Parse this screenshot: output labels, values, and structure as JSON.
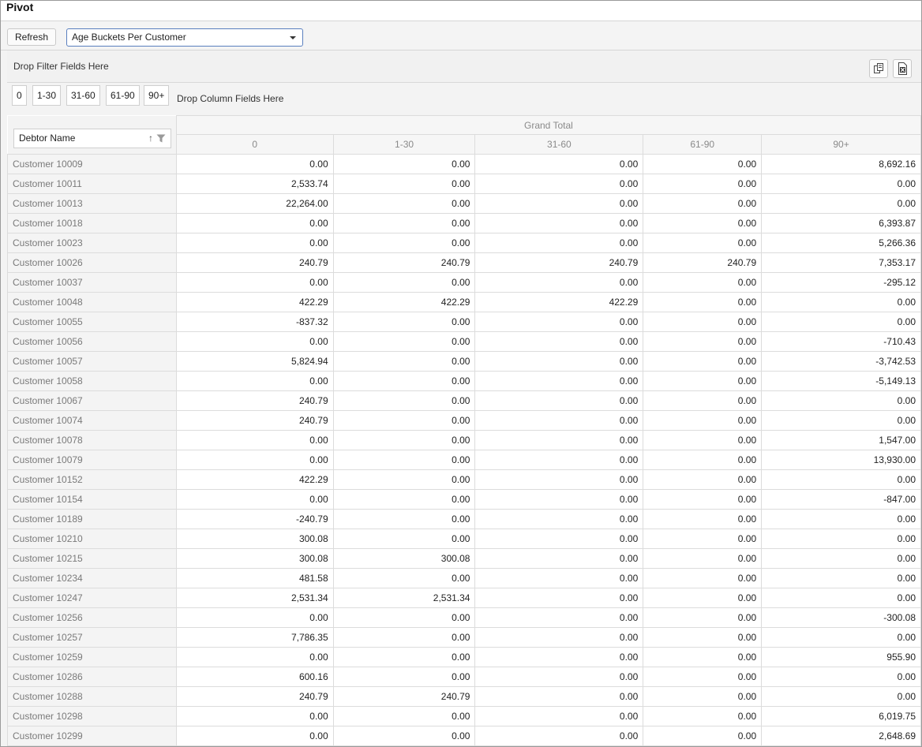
{
  "title": "Pivot",
  "toolbar": {
    "refresh_label": "Refresh",
    "report_select": "Age Buckets Per Customer"
  },
  "filter_zone": {
    "label": "Drop Filter Fields Here"
  },
  "column_zone": {
    "chips": [
      "0",
      "1-30",
      "31-60",
      "61-90",
      "90+"
    ],
    "label": "Drop Column Fields Here"
  },
  "row_field": {
    "label": "Debtor Name"
  },
  "grid": {
    "grand_total_label": "Grand Total",
    "columns": [
      "0",
      "1-30",
      "31-60",
      "61-90",
      "90+"
    ],
    "rows": [
      {
        "name": "Customer 10009",
        "values": [
          "0.00",
          "0.00",
          "0.00",
          "0.00",
          "8,692.16"
        ]
      },
      {
        "name": "Customer 10011",
        "values": [
          "2,533.74",
          "0.00",
          "0.00",
          "0.00",
          "0.00"
        ]
      },
      {
        "name": "Customer 10013",
        "values": [
          "22,264.00",
          "0.00",
          "0.00",
          "0.00",
          "0.00"
        ]
      },
      {
        "name": "Customer 10018",
        "values": [
          "0.00",
          "0.00",
          "0.00",
          "0.00",
          "6,393.87"
        ]
      },
      {
        "name": "Customer 10023",
        "values": [
          "0.00",
          "0.00",
          "0.00",
          "0.00",
          "5,266.36"
        ]
      },
      {
        "name": "Customer 10026",
        "values": [
          "240.79",
          "240.79",
          "240.79",
          "240.79",
          "7,353.17"
        ]
      },
      {
        "name": "Customer 10037",
        "values": [
          "0.00",
          "0.00",
          "0.00",
          "0.00",
          "-295.12"
        ]
      },
      {
        "name": "Customer 10048",
        "values": [
          "422.29",
          "422.29",
          "422.29",
          "0.00",
          "0.00"
        ]
      },
      {
        "name": "Customer 10055",
        "values": [
          "-837.32",
          "0.00",
          "0.00",
          "0.00",
          "0.00"
        ]
      },
      {
        "name": "Customer 10056",
        "values": [
          "0.00",
          "0.00",
          "0.00",
          "0.00",
          "-710.43"
        ]
      },
      {
        "name": "Customer 10057",
        "values": [
          "5,824.94",
          "0.00",
          "0.00",
          "0.00",
          "-3,742.53"
        ]
      },
      {
        "name": "Customer 10058",
        "values": [
          "0.00",
          "0.00",
          "0.00",
          "0.00",
          "-5,149.13"
        ]
      },
      {
        "name": "Customer 10067",
        "values": [
          "240.79",
          "0.00",
          "0.00",
          "0.00",
          "0.00"
        ]
      },
      {
        "name": "Customer 10074",
        "values": [
          "240.79",
          "0.00",
          "0.00",
          "0.00",
          "0.00"
        ]
      },
      {
        "name": "Customer 10078",
        "values": [
          "0.00",
          "0.00",
          "0.00",
          "0.00",
          "1,547.00"
        ]
      },
      {
        "name": "Customer 10079",
        "values": [
          "0.00",
          "0.00",
          "0.00",
          "0.00",
          "13,930.00"
        ]
      },
      {
        "name": "Customer 10152",
        "values": [
          "422.29",
          "0.00",
          "0.00",
          "0.00",
          "0.00"
        ]
      },
      {
        "name": "Customer 10154",
        "values": [
          "0.00",
          "0.00",
          "0.00",
          "0.00",
          "-847.00"
        ]
      },
      {
        "name": "Customer 10189",
        "values": [
          "-240.79",
          "0.00",
          "0.00",
          "0.00",
          "0.00"
        ]
      },
      {
        "name": "Customer 10210",
        "values": [
          "300.08",
          "0.00",
          "0.00",
          "0.00",
          "0.00"
        ]
      },
      {
        "name": "Customer 10215",
        "values": [
          "300.08",
          "300.08",
          "0.00",
          "0.00",
          "0.00"
        ]
      },
      {
        "name": "Customer 10234",
        "values": [
          "481.58",
          "0.00",
          "0.00",
          "0.00",
          "0.00"
        ]
      },
      {
        "name": "Customer 10247",
        "values": [
          "2,531.34",
          "2,531.34",
          "0.00",
          "0.00",
          "0.00"
        ]
      },
      {
        "name": "Customer 10256",
        "values": [
          "0.00",
          "0.00",
          "0.00",
          "0.00",
          "-300.08"
        ]
      },
      {
        "name": "Customer 10257",
        "values": [
          "7,786.35",
          "0.00",
          "0.00",
          "0.00",
          "0.00"
        ]
      },
      {
        "name": "Customer 10259",
        "values": [
          "0.00",
          "0.00",
          "0.00",
          "0.00",
          "955.90"
        ]
      },
      {
        "name": "Customer 10286",
        "values": [
          "600.16",
          "0.00",
          "0.00",
          "0.00",
          "0.00"
        ]
      },
      {
        "name": "Customer 10288",
        "values": [
          "240.79",
          "240.79",
          "0.00",
          "0.00",
          "0.00"
        ]
      },
      {
        "name": "Customer 10298",
        "values": [
          "0.00",
          "0.00",
          "0.00",
          "0.00",
          "6,019.75"
        ]
      },
      {
        "name": "Customer 10299",
        "values": [
          "0.00",
          "0.00",
          "0.00",
          "0.00",
          "2,648.69"
        ]
      }
    ]
  }
}
